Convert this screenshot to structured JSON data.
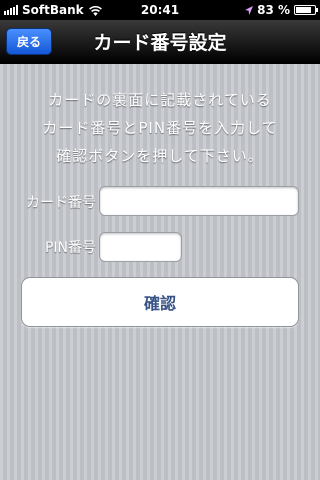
{
  "status_bar": {
    "carrier": "SoftBank",
    "time": "20:41",
    "battery_percent": "83 %",
    "battery_level": 0.83
  },
  "nav": {
    "back_label": "戻る",
    "title": "カード番号設定"
  },
  "instructions": {
    "line1": "カードの裏面に記載されている",
    "line2": "カード番号とPIN番号を入力して",
    "line3": "確認ボタンを押して下さい。"
  },
  "form": {
    "card_label": "カード番号",
    "card_value": "",
    "pin_label": "PIN番号",
    "pin_value": "",
    "confirm_label": "確認"
  },
  "colors": {
    "background": "#c6c9cf",
    "nav_bar": "#000000",
    "back_button": "#1f6ae6",
    "button_text": "#385487"
  }
}
